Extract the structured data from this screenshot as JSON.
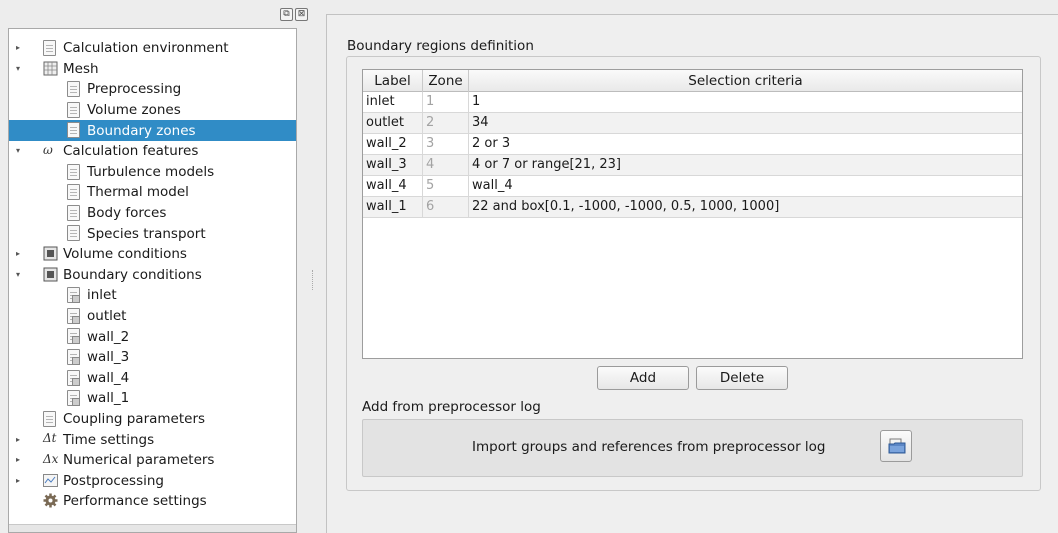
{
  "dock": {
    "float_glyph": "⧉",
    "close_glyph": "⊠"
  },
  "tree": {
    "items": [
      {
        "label": "Calculation environment",
        "arrow": "▸",
        "icon": "document-icon"
      },
      {
        "label": "Mesh",
        "arrow": "▾",
        "icon": "mesh-icon"
      },
      {
        "label": "Preprocessing",
        "arrow": "",
        "icon": "document-icon"
      },
      {
        "label": "Volume zones",
        "arrow": "",
        "icon": "document-icon"
      },
      {
        "label": "Boundary zones",
        "arrow": "",
        "icon": "document-icon",
        "selected": true
      },
      {
        "label": "Calculation features",
        "arrow": "▾",
        "icon": "features-icon",
        "glyph": "ω"
      },
      {
        "label": "Turbulence models",
        "arrow": "",
        "icon": "document-icon"
      },
      {
        "label": "Thermal model",
        "arrow": "",
        "icon": "document-icon"
      },
      {
        "label": "Body forces",
        "arrow": "",
        "icon": "document-icon"
      },
      {
        "label": "Species transport",
        "arrow": "",
        "icon": "document-icon"
      },
      {
        "label": "Volume conditions",
        "arrow": "▸",
        "icon": "volume-icon"
      },
      {
        "label": "Boundary conditions",
        "arrow": "▾",
        "icon": "boundary-icon"
      },
      {
        "label": "inlet",
        "arrow": "",
        "icon": "document-icon"
      },
      {
        "label": "outlet",
        "arrow": "",
        "icon": "document-icon"
      },
      {
        "label": "wall_2",
        "arrow": "",
        "icon": "document-icon"
      },
      {
        "label": "wall_3",
        "arrow": "",
        "icon": "document-icon"
      },
      {
        "label": "wall_4",
        "arrow": "",
        "icon": "document-icon"
      },
      {
        "label": "wall_1",
        "arrow": "",
        "icon": "document-icon"
      },
      {
        "label": "Coupling parameters",
        "arrow": "",
        "icon": "document-icon"
      },
      {
        "label": "Time settings",
        "arrow": "▸",
        "icon": "delta-t-icon",
        "glyph": "Δt"
      },
      {
        "label": "Numerical parameters",
        "arrow": "▸",
        "icon": "delta-x-icon",
        "glyph": "Δx"
      },
      {
        "label": "Postprocessing",
        "arrow": "▸",
        "icon": "chart-icon"
      },
      {
        "label": "Performance settings",
        "arrow": "",
        "icon": "gear-icon"
      }
    ]
  },
  "main": {
    "group_title": "Boundary regions definition",
    "table": {
      "headers": [
        "Label",
        "Zone",
        "Selection criteria"
      ],
      "rows": [
        [
          "inlet",
          "1",
          "1"
        ],
        [
          "outlet",
          "2",
          "34"
        ],
        [
          "wall_2",
          "3",
          "2 or 3"
        ],
        [
          "wall_3",
          "4",
          "4 or 7 or range[21, 23]"
        ],
        [
          "wall_4",
          "5",
          "wall_4"
        ],
        [
          "wall_1",
          "6",
          "22 and box[0.1, -1000, -1000, 0.5, 1000, 1000]"
        ]
      ]
    },
    "add_label": "Add",
    "delete_label": "Delete",
    "preprocessor_section": "Add from preprocessor log",
    "import_text": "Import groups and references from preprocessor log"
  },
  "colors": {
    "selection": "#308cc6",
    "window_bg": "#ededed"
  }
}
